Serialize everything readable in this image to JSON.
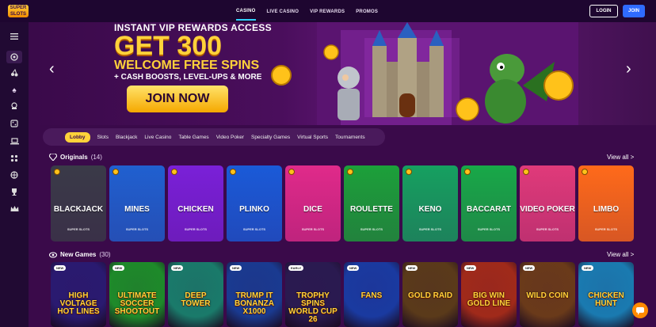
{
  "logo": {
    "text": "SUPER SLOTS"
  },
  "nav": {
    "links": [
      "CASINO",
      "LIVE CASINO",
      "VIP REWARDS",
      "PROMOS"
    ],
    "login": "LOGIN",
    "join": "JOIN"
  },
  "sidebar": {
    "icons": [
      "menu-icon",
      "casino-chip-icon",
      "cherries-icon",
      "spade-icon",
      "dealer-icon",
      "dice-icon",
      "laptop-icon",
      "grid-icon",
      "basketball-icon",
      "trophy-icon",
      "crown-icon"
    ]
  },
  "hero": {
    "line1": "INSTANT VIP REWARDS ACCESS",
    "line2": "GET 300",
    "line3": "WELCOME FREE SPINS",
    "line4": "+ CASH BOOSTS, LEVEL-UPS & MORE",
    "cta": "JOIN NOW",
    "prev_arrow": "‹",
    "next_arrow": "›"
  },
  "tabs": [
    "Lobby",
    "Slots",
    "Blackjack",
    "Live Casino",
    "Table Games",
    "Video Poker",
    "Specialty Games",
    "Virtual Sports",
    "Tournaments"
  ],
  "originals": {
    "title": "Originals",
    "count": "(14)",
    "view_all": "View all >",
    "cards": [
      {
        "label": "BLACKJACK",
        "color": "#3a3a48",
        "brand": "SUPER SLOTS"
      },
      {
        "label": "MINES",
        "color": "#2060d0",
        "brand": "SUPER SLOTS"
      },
      {
        "label": "CHICKEN",
        "color": "#7a20d8",
        "brand": "SUPER SLOTS"
      },
      {
        "label": "PLINKO",
        "color": "#1a5ad8",
        "brand": "SUPER SLOTS"
      },
      {
        "label": "DICE",
        "color": "#e02a8a",
        "brand": "SUPER SLOTS"
      },
      {
        "label": "ROULETTE",
        "color": "#1ca03a",
        "brand": "SUPER SLOTS"
      },
      {
        "label": "KENO",
        "color": "#16a060",
        "brand": "SUPER SLOTS"
      },
      {
        "label": "BACCARAT",
        "color": "#18a848",
        "brand": "SUPER SLOTS"
      },
      {
        "label": "VIDEO POKER",
        "color": "#e03a7a",
        "brand": "SUPER SLOTS"
      },
      {
        "label": "LIMBO",
        "color": "#ff6a1a",
        "brand": "SUPER SLOTS"
      }
    ]
  },
  "new_games": {
    "title": "New Games",
    "count": "(30)",
    "view_all": "View all >",
    "cards": [
      {
        "title": "HIGH VOLTAGE HOT LINES",
        "badge": "NEW",
        "color": "#2a1a70"
      },
      {
        "title": "ULTIMATE SOCCER SHOOTOUT",
        "badge": "NEW",
        "color": "#1e8a2a"
      },
      {
        "title": "DEEP TOWER",
        "badge": "NEW",
        "color": "#1a7a6a"
      },
      {
        "title": "TRUMP IT BONANZA X1000",
        "badge": "NEW",
        "color": "#1a3a90"
      },
      {
        "title": "TROPHY SPINS WORLD CUP 26",
        "badge": "EARLY",
        "color": "#2a1a50"
      },
      {
        "title": "FANS",
        "badge": "NEW",
        "color": "#1a3aa0"
      },
      {
        "title": "GOLD RAID",
        "badge": "NEW",
        "color": "#5a3a1a"
      },
      {
        "title": "BIG WIN GOLD LINE",
        "badge": "NEW",
        "color": "#a02a1a"
      },
      {
        "title": "WILD COIN",
        "badge": "NEW",
        "color": "#6a3a1a"
      },
      {
        "title": "CHICKEN HUNT",
        "badge": "NEW",
        "color": "#1a7ab0"
      }
    ]
  },
  "chat": {
    "icon": "chat-icon"
  }
}
